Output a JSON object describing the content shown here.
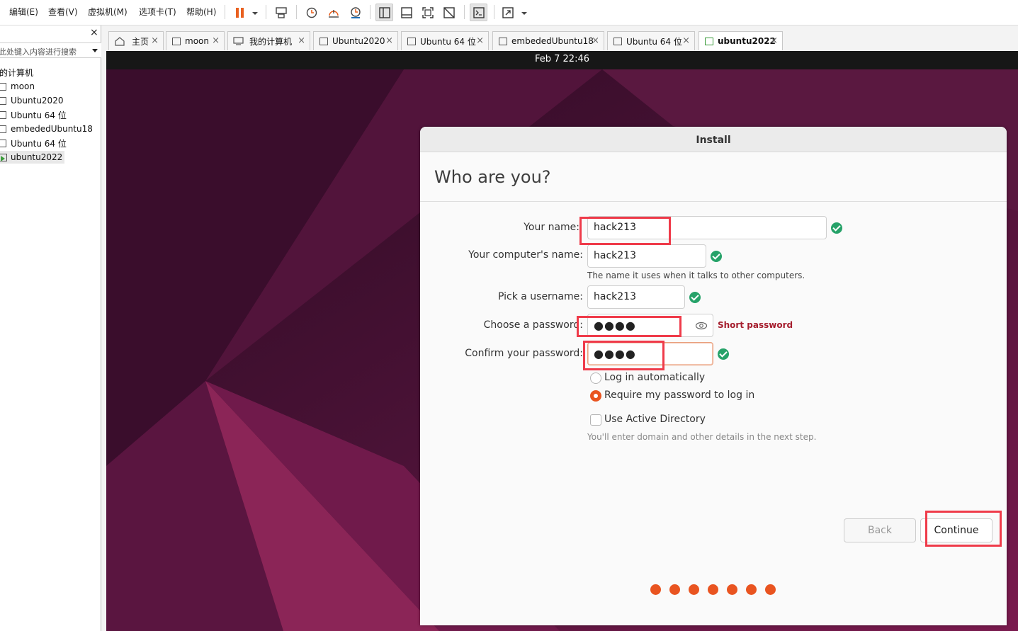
{
  "menubar": {
    "items": [
      "编辑(E)",
      "查看(V)",
      "虚拟机(M)",
      "选项卡(T)",
      "帮助(H)"
    ]
  },
  "toolbar": {
    "icons": [
      "pause-icon",
      "send-ctrl-alt-del-icon",
      "snapshot-icon",
      "revert-snapshot-icon",
      "snapshot-manager-icon",
      "show-library-icon",
      "thumbnail-bar-icon",
      "full-screen-icon",
      "unity-icon",
      "console-icon",
      "stretch-icon"
    ],
    "accent": "#e9601f"
  },
  "sidebar": {
    "close_label": "×",
    "search_placeholder": "在此处键入内容进行搜索",
    "root_label": "我的计算机",
    "items": [
      {
        "label": "moon"
      },
      {
        "label": "Ubuntu2020"
      },
      {
        "label": "Ubuntu 64 位"
      },
      {
        "label": "embededUbuntu18"
      },
      {
        "label": "Ubuntu 64 位"
      },
      {
        "label": "ubuntu2022"
      }
    ]
  },
  "tabs": [
    {
      "label": "主页",
      "icon": "home-icon"
    },
    {
      "label": "moon",
      "icon": "vm-icon"
    },
    {
      "label": "我的计算机",
      "icon": "computer-icon"
    },
    {
      "label": "Ubuntu2020",
      "icon": "vm-icon"
    },
    {
      "label": "Ubuntu 64 位",
      "icon": "vm-icon"
    },
    {
      "label": "embededUbuntu18",
      "icon": "vm-icon"
    },
    {
      "label": "Ubuntu 64 位",
      "icon": "vm-icon"
    },
    {
      "label": "ubuntu2022",
      "icon": "vm-running-icon",
      "active": true
    }
  ],
  "tab_close": "×",
  "guest": {
    "clock": "Feb 7  22:46",
    "installer": {
      "window_title": "Install",
      "heading": "Who are you?",
      "your_name": {
        "label": "Your name:",
        "value": "hack213"
      },
      "computer_name": {
        "label": "Your computer's name:",
        "value": "hack213",
        "hint": "The name it uses when it talks to other computers."
      },
      "username": {
        "label": "Pick a username:",
        "value": "hack213"
      },
      "password": {
        "label": "Choose a password:",
        "value": "●●●●",
        "strength": "Short password"
      },
      "confirm_password": {
        "label": "Confirm your password:",
        "value": "●●●●"
      },
      "login_options": [
        {
          "label": "Log in automatically",
          "selected": false
        },
        {
          "label": "Require my password to log in",
          "selected": true
        }
      ],
      "active_directory": {
        "label": "Use Active Directory",
        "checked": false,
        "hint": "You'll enter domain and other details in the next step."
      },
      "back_label": "Back",
      "continue_label": "Continue",
      "progress_steps": 7,
      "accent": "#e95420"
    }
  },
  "annotation_color": "#ef3b4a"
}
